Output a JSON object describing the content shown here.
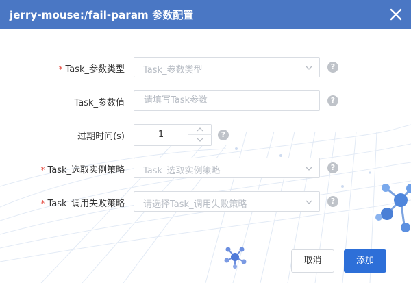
{
  "dialog": {
    "title": "jerry-mouse:/fail-param 参数配置",
    "close_icon": "close-icon"
  },
  "form": {
    "required_marker": "*",
    "task_param_type": {
      "label": "Task_参数类型",
      "required": true,
      "placeholder": "Task_参数类型",
      "help": "?"
    },
    "task_param_value": {
      "label": "Task_参数值",
      "required": false,
      "placeholder": "请填写Task参数",
      "help": "?"
    },
    "expire_time": {
      "label": "过期时间(s)",
      "value": "1",
      "help": "?"
    },
    "task_instance_strategy": {
      "label": "Task_选取实例策略",
      "required": true,
      "placeholder": "Task_选取实例策略",
      "help": "?"
    },
    "task_failure_strategy": {
      "label": "Task_调用失败策略",
      "required": true,
      "placeholder": "请选择Task_调用失败策略",
      "help": "?"
    }
  },
  "buttons": {
    "cancel_label": "取消",
    "add_label": "添加"
  },
  "colors": {
    "header": "#4a77c4",
    "primary": "#2d6fd8",
    "required": "#e54d42",
    "help_icon": "#bfc3c9"
  }
}
